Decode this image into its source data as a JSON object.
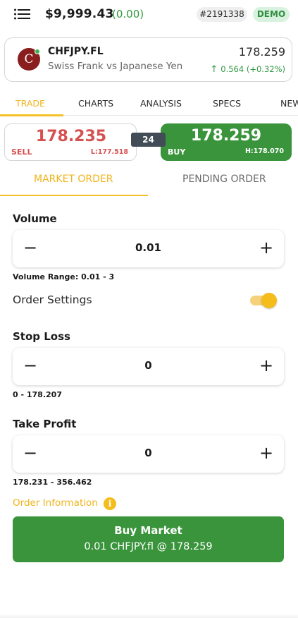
{
  "header": {
    "balance": "$9,999.43",
    "balance_change": "(0.00)",
    "account_id": "#2191338",
    "account_type": "DEMO"
  },
  "symbol": {
    "avatar_letter": "C",
    "name": "CHFJPY.FL",
    "description": "Swiss Frank vs Japanese Yen",
    "price": "178.259",
    "change": "0.564 (+0.32%)",
    "change_icon": "arrow-up-icon"
  },
  "tabs": [
    {
      "label": "TRADE",
      "active": true
    },
    {
      "label": "CHARTS",
      "active": false
    },
    {
      "label": "ANALYSIS",
      "active": false
    },
    {
      "label": "SPECS",
      "active": false
    },
    {
      "label": "NEW",
      "active": false
    }
  ],
  "quotes": {
    "sell_price": "178.235",
    "sell_label": "SELL",
    "low": "L:177.518",
    "spread": "24",
    "buy_price": "178.259",
    "buy_label": "BUY",
    "high": "H:178.070"
  },
  "order_types": {
    "market": "MARKET ORDER",
    "pending": "PENDING ORDER"
  },
  "volume": {
    "label": "Volume",
    "value": "0.01",
    "range": "Volume Range: 0.01 - 3"
  },
  "order_settings": {
    "label": "Order Settings",
    "enabled": true
  },
  "stop_loss": {
    "label": "Stop Loss",
    "value": "0",
    "range": "0 - 178.207"
  },
  "take_profit": {
    "label": "Take Profit",
    "value": "0",
    "range": "178.231 - 356.462"
  },
  "order_information": {
    "label": "Order Information",
    "icon": "info-icon"
  },
  "buy_market": {
    "title": "Buy Market",
    "subtitle": "0.01 CHFJPY.fl @ 178.259"
  },
  "colors": {
    "accent": "#f5c226",
    "sell": "#d75050",
    "buy": "#3a943c",
    "positive": "#2f9a41"
  }
}
